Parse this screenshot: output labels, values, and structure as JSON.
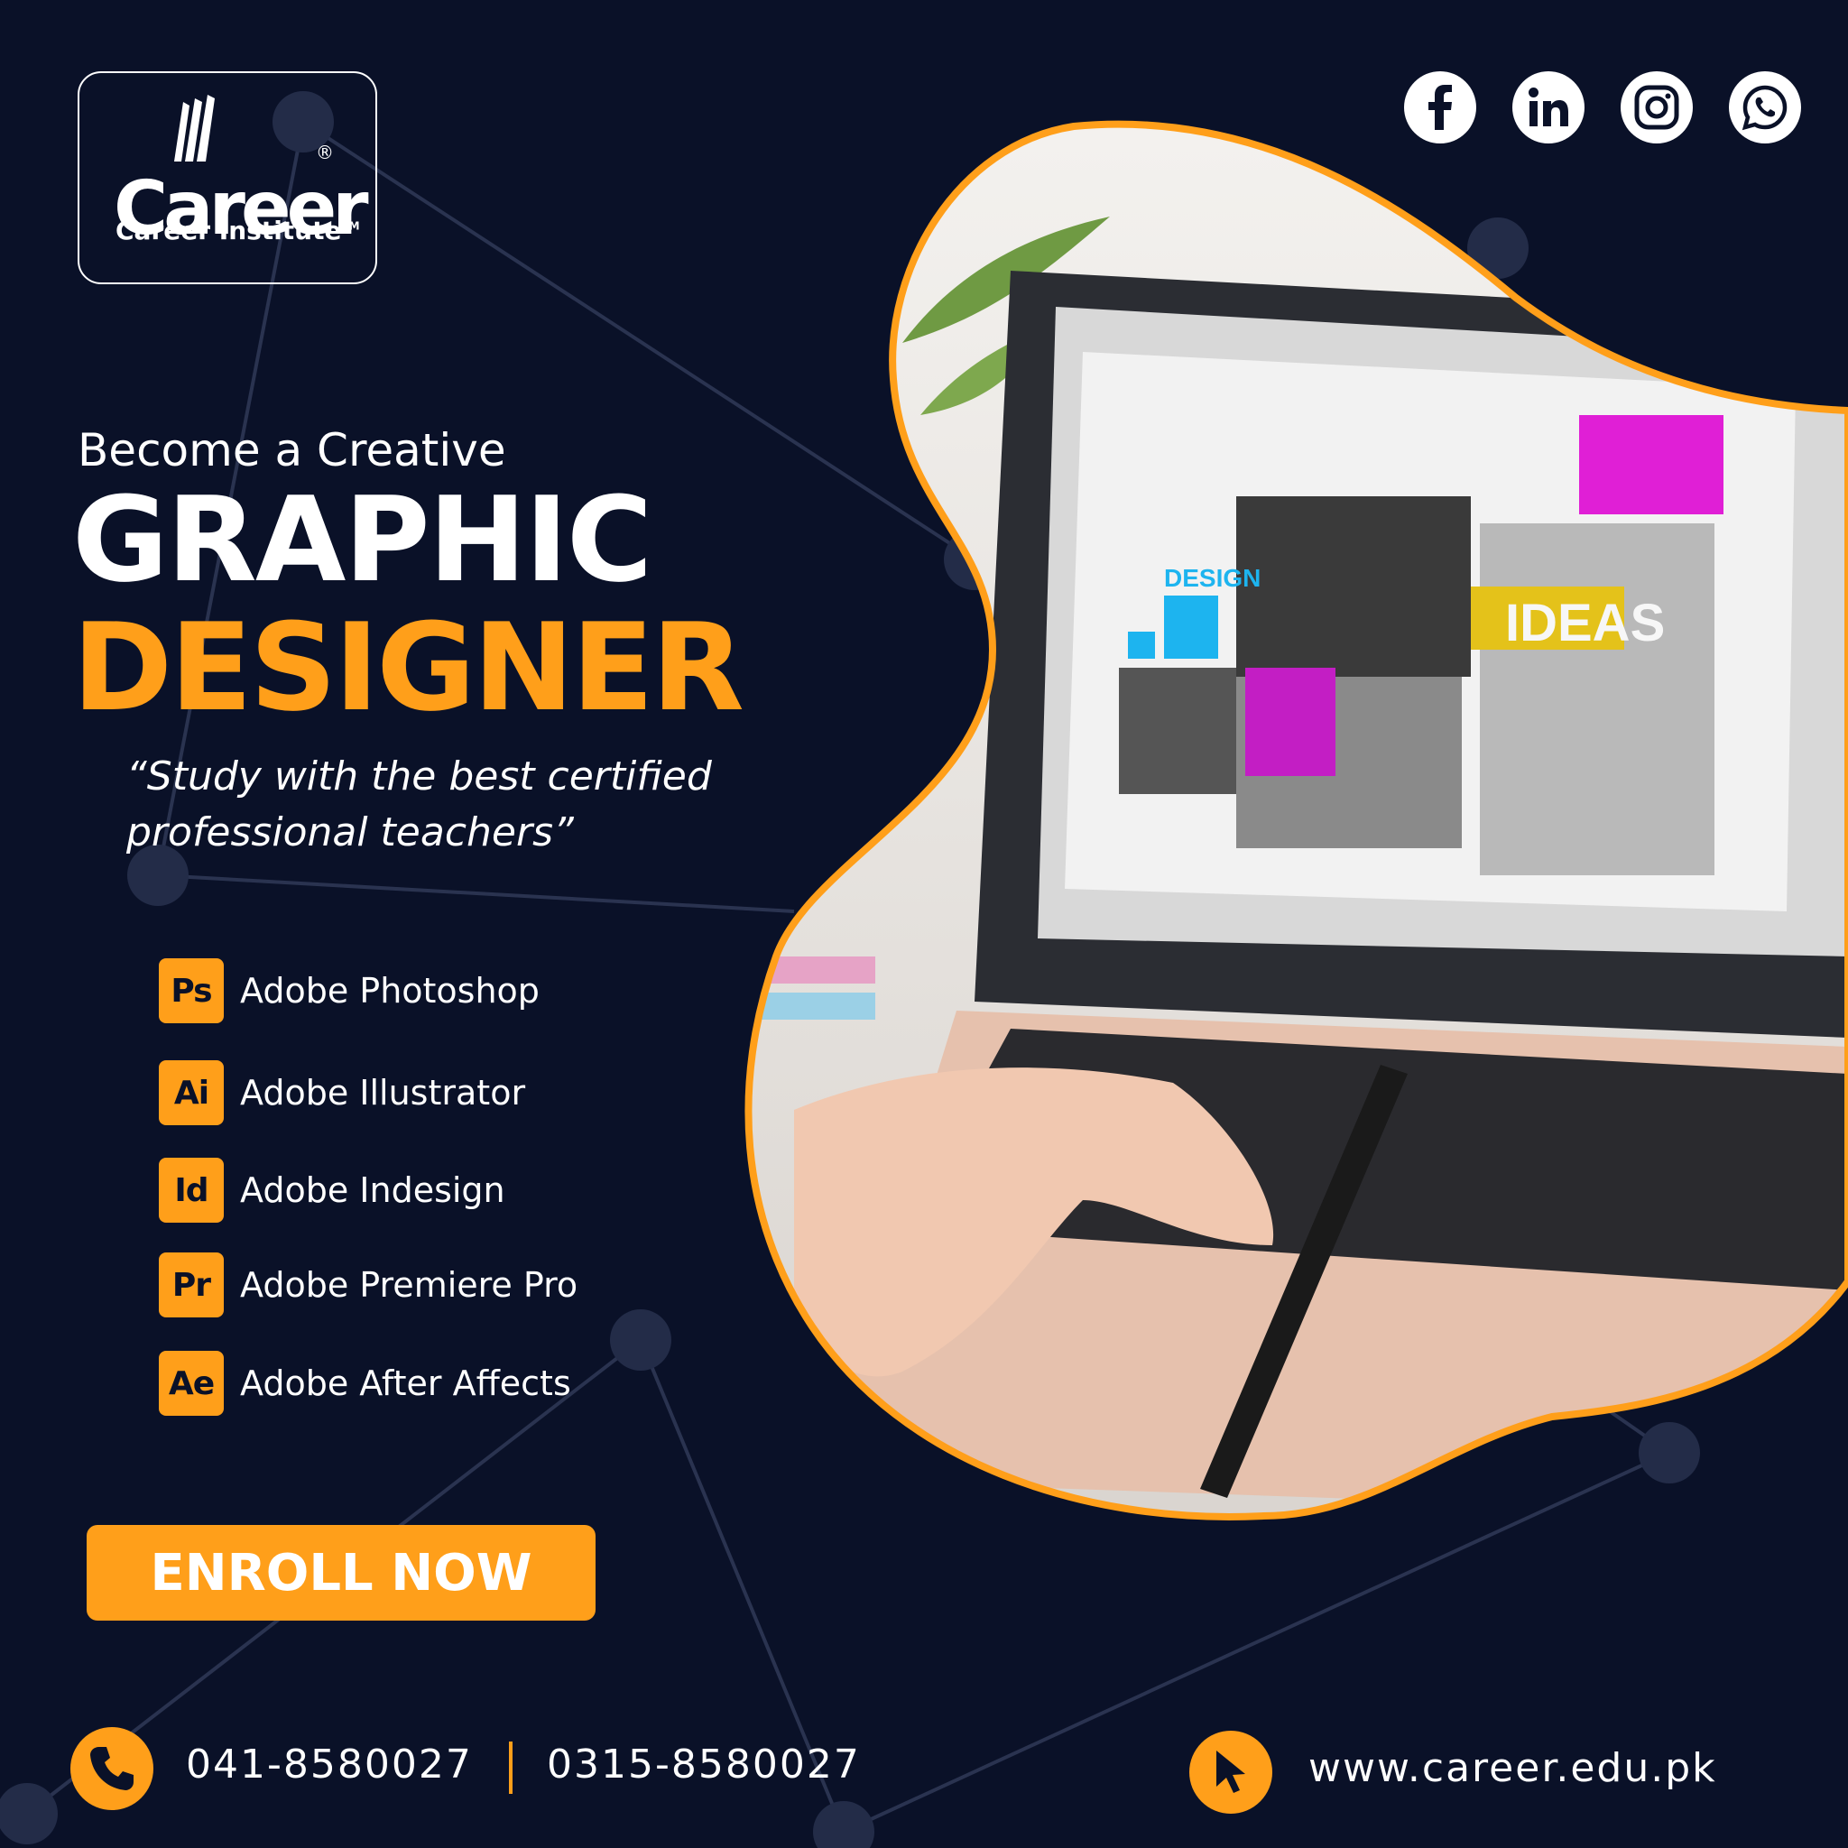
{
  "brand": {
    "logo_word": "Career",
    "registered_mark": "®",
    "logo_subtitle": "Career Institute",
    "trademark": "TM"
  },
  "social": [
    {
      "icon": "facebook-icon",
      "glyph": "f"
    },
    {
      "icon": "linkedin-icon",
      "glyph": "in"
    },
    {
      "icon": "instagram-icon",
      "glyph": ""
    },
    {
      "icon": "whatsapp-icon",
      "glyph": ""
    }
  ],
  "headline": {
    "pre": "Become a Creative",
    "line1": "GRAPHIC",
    "line2": "DESIGNER"
  },
  "quote": "“Study with the best certified professional teachers”",
  "software": [
    {
      "badge": "Ps",
      "name": "Adobe Photoshop"
    },
    {
      "badge": "Ai",
      "name": "Adobe Illustrator"
    },
    {
      "badge": "Id",
      "name": "Adobe Indesign"
    },
    {
      "badge": "Pr",
      "name": "Adobe Premiere Pro"
    },
    {
      "badge": "Ae",
      "name": "Adobe After Affects"
    }
  ],
  "cta": "ENROLL NOW",
  "contact": {
    "phone1": "041-8580027",
    "phone2": "0315-8580027",
    "website": "www.career.edu.pk"
  },
  "screen_labels": {
    "design": "DESIGN",
    "ideas": "IDEAS"
  },
  "colors": {
    "background": "#0a1128",
    "accent": "#ff9f1a",
    "text": "#ffffff"
  }
}
